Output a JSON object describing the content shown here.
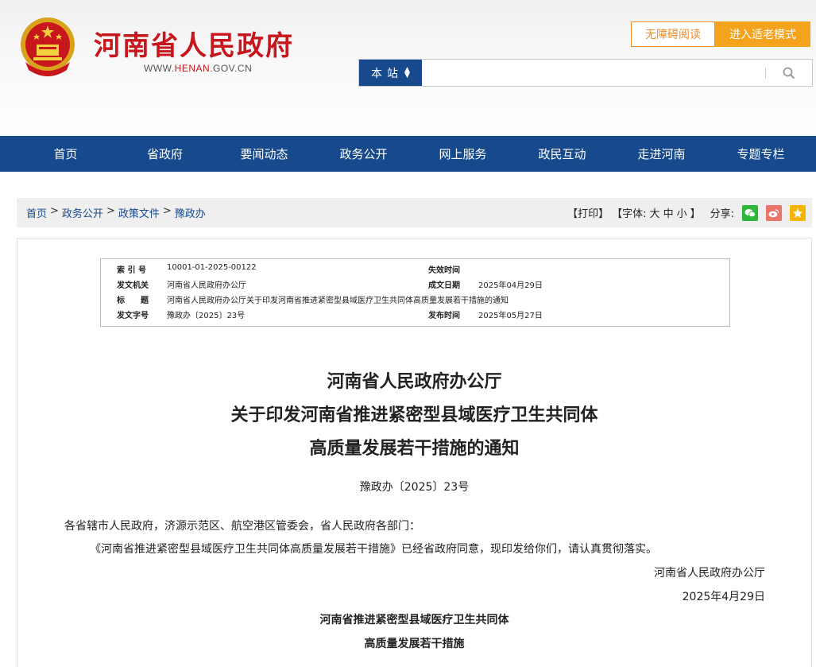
{
  "header": {
    "site_title": "河南省人民政府",
    "site_url_prefix": "WWW.",
    "site_url_domain": "HENAN",
    "site_url_suffix": ".GOV.CN",
    "accessibility_button": "无障碍阅读",
    "elder_mode_button": "进入适老模式",
    "search_scope": "本站",
    "search_placeholder": "",
    "colors": {
      "brand_red": "#c8161d",
      "nav_blue": "#174a8c",
      "accent_orange": "#f5a21c"
    }
  },
  "nav": {
    "items": [
      "首页",
      "省政府",
      "要闻动态",
      "政务公开",
      "网上服务",
      "政民互动",
      "走进河南",
      "专题专栏"
    ]
  },
  "breadcrumb": {
    "items": [
      "首页",
      "政务公开",
      "政策文件",
      "豫政办"
    ],
    "separator": ">",
    "print": "【打印】",
    "font_label": "【字体:",
    "font_large": "大",
    "font_medium": "中",
    "font_small": "小",
    "font_close": "】",
    "share_label": "分享:",
    "share_icons": [
      "wechat-icon",
      "weibo-icon",
      "favorite-icon"
    ]
  },
  "meta": {
    "index_label": "索 引 号",
    "index_value": "10001-01-2025-00122",
    "expire_label": "失效时间",
    "expire_value": "",
    "issuer_label": "发文机关",
    "issuer_value": "河南省人民政府办公厅",
    "date_label": "成文日期",
    "date_value": "2025年04月29日",
    "title_label": "标　　题",
    "title_value": "河南省人民政府办公厅关于印发河南省推进紧密型县域医疗卫生共同体高质量发展若干措施的通知",
    "docno_label": "发文字号",
    "docno_value": "豫政办〔2025〕23号",
    "publish_label": "发布时间",
    "publish_value": "2025年05月27日"
  },
  "document": {
    "title_line1": "河南省人民政府办公厅",
    "title_line2": "关于印发河南省推进紧密型县域医疗卫生共同体",
    "title_line3": "高质量发展若干措施的通知",
    "doc_number": "豫政办〔2025〕23号",
    "salutation": "各省辖市人民政府，济源示范区、航空港区管委会，省人民政府各部门：",
    "paragraph1": "《河南省推进紧密型县域医疗卫生共同体高质量发展若干措施》已经省政府同意，现印发给你们，请认真贯彻落实。",
    "signature": "河南省人民政府办公厅",
    "sign_date": "2025年4月29日",
    "attachment_title1": "河南省推进紧密型县域医疗卫生共同体",
    "attachment_title2": "高质量发展若干措施"
  }
}
